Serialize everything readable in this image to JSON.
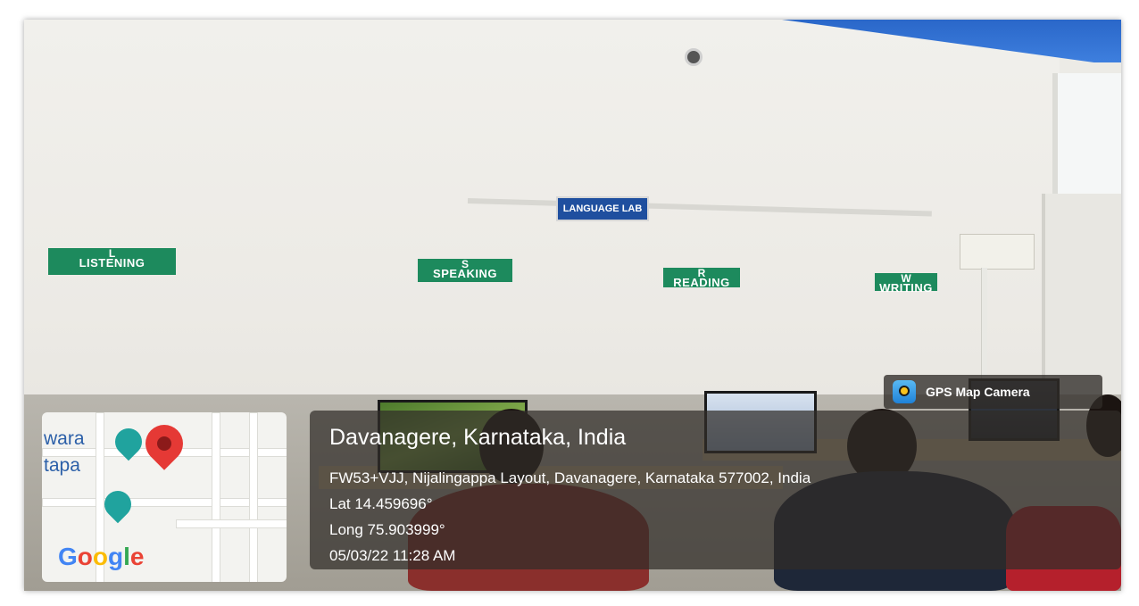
{
  "wall_signs": {
    "lab": "LANGUAGE LAB",
    "listening": {
      "letter": "L",
      "word": "LISTENING"
    },
    "speaking": {
      "letter": "S",
      "word": "SPEAKING"
    },
    "reading": {
      "letter": "R",
      "word": "READING"
    },
    "writing": {
      "letter": "W",
      "word": "WRITING"
    }
  },
  "gps_tag": {
    "label": "GPS Map Camera",
    "icon": "gps-camera-icon"
  },
  "location": {
    "title": "Davanagere, Karnataka, India",
    "address": "FW53+VJJ, Nijalingappa Layout, Davanagere, Karnataka 577002, India",
    "lat": "Lat 14.459696°",
    "long": "Long 75.903999°",
    "datetime": "05/03/22 11:28 AM"
  },
  "map": {
    "label_1": "wara",
    "label_2": "tapa",
    "logo": [
      "G",
      "o",
      "o",
      "g",
      "l",
      "e"
    ],
    "pin_color": "#e53935"
  }
}
